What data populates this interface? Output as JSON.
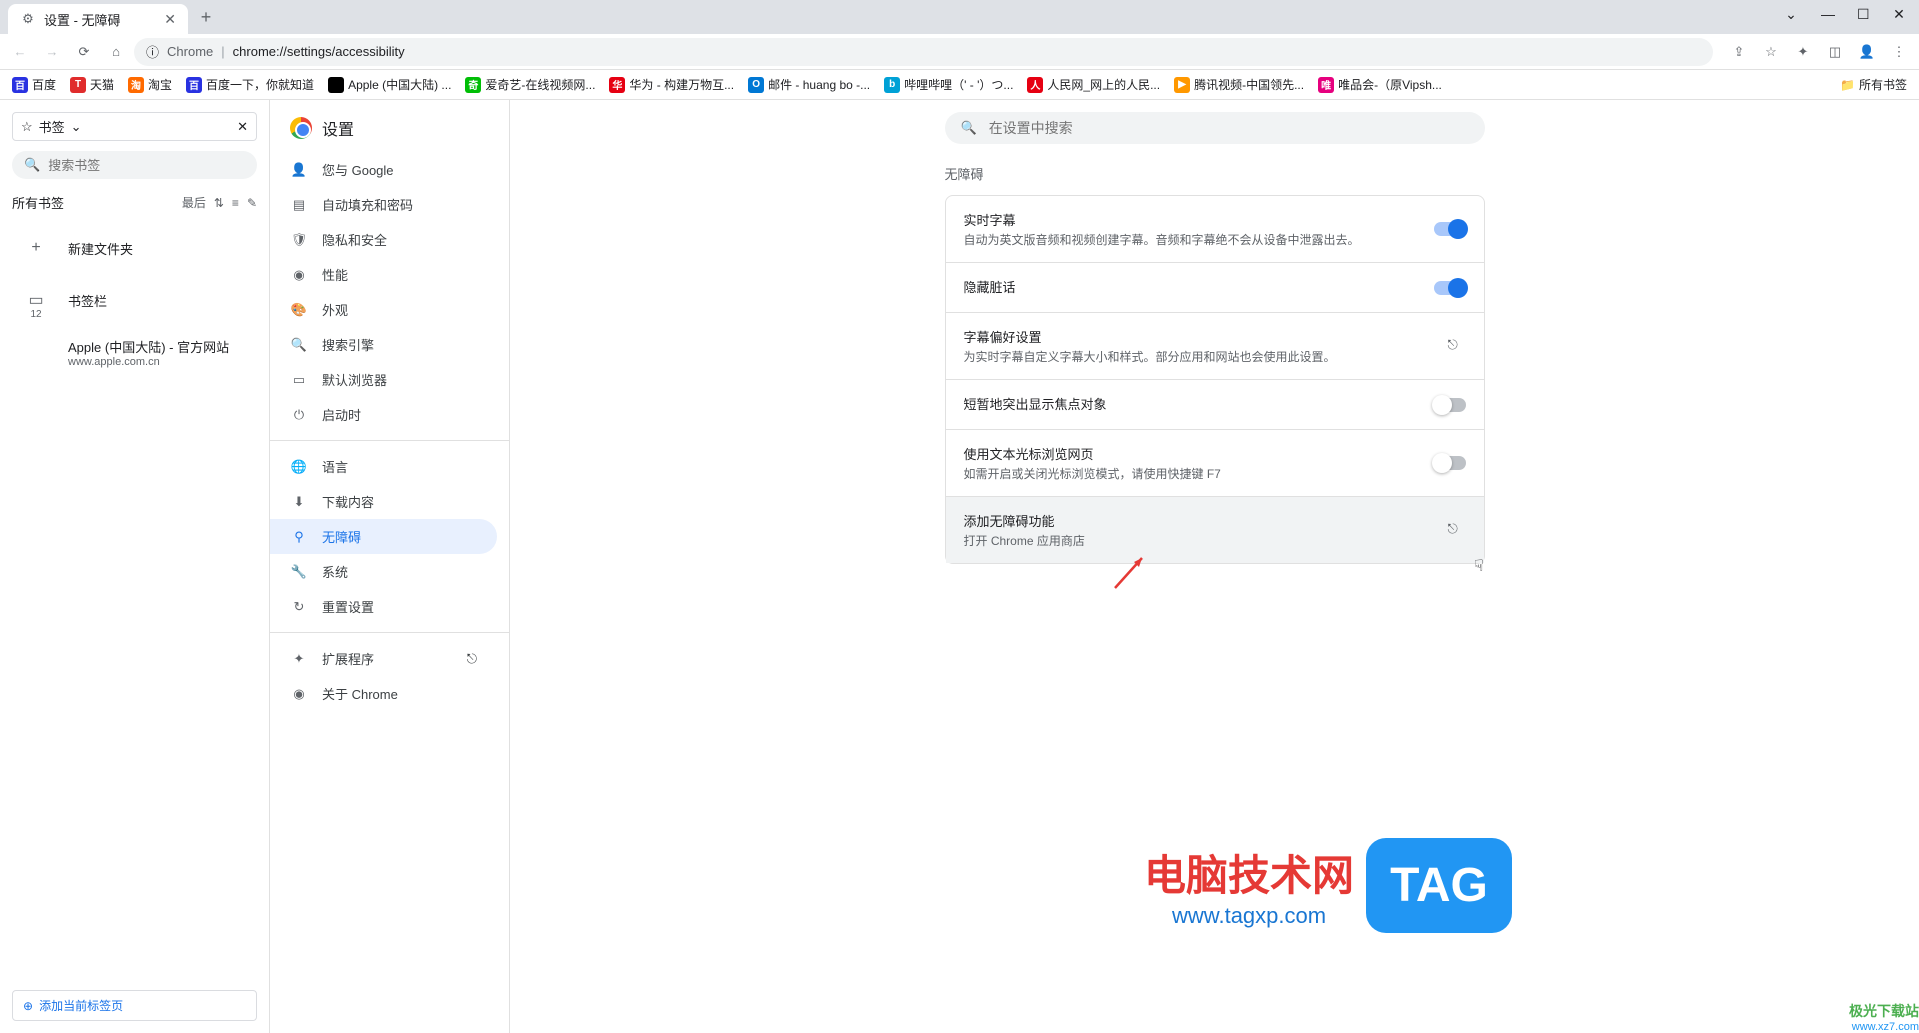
{
  "window": {
    "tab_title": "设置 - 无障碍"
  },
  "toolbar": {
    "chrome_label": "Chrome",
    "url": "chrome://settings/accessibility"
  },
  "bookmarks_bar": {
    "items": [
      {
        "label": "百度",
        "color": "#2932e1"
      },
      {
        "label": "天猫",
        "color": "#e02c2c"
      },
      {
        "label": "淘宝",
        "color": "#ff6a00"
      },
      {
        "label": "百度一下，你就知道",
        "color": "#2932e1"
      },
      {
        "label": "Apple (中国大陆) ...",
        "color": "#000"
      },
      {
        "label": "爱奇艺-在线视频网...",
        "color": "#00be06"
      },
      {
        "label": "华为 - 构建万物互...",
        "color": "#e60012"
      },
      {
        "label": "邮件 - huang bo -...",
        "color": "#0078d4"
      },
      {
        "label": "哔哩哔哩（' - '）つ...",
        "color": "#00a1d6"
      },
      {
        "label": "人民网_网上的人民...",
        "color": "#e60012"
      },
      {
        "label": "腾讯视频-中国领先...",
        "color": "#ff9800"
      },
      {
        "label": "唯品会-（原Vipsh...",
        "color": "#e6007e"
      }
    ],
    "right_label": "所有书签"
  },
  "bookmark_panel": {
    "dropdown_label": "书签",
    "search_placeholder": "搜索书签",
    "all_bookmarks": "所有书签",
    "sort_label": "最后",
    "new_folder": "新建文件夹",
    "bookmark_bar_label": "书签栏",
    "bookmark_bar_count": "12",
    "apple_title": "Apple (中国大陆) - 官方网站",
    "apple_url": "www.apple.com.cn",
    "add_current": "添加当前标签页"
  },
  "settings": {
    "title": "设置",
    "search_placeholder": "在设置中搜索",
    "nav": [
      {
        "icon": "person",
        "label": "您与 Google"
      },
      {
        "icon": "autofill",
        "label": "自动填充和密码"
      },
      {
        "icon": "privacy",
        "label": "隐私和安全"
      },
      {
        "icon": "performance",
        "label": "性能"
      },
      {
        "icon": "appearance",
        "label": "外观"
      },
      {
        "icon": "search",
        "label": "搜索引擎"
      },
      {
        "icon": "browser",
        "label": "默认浏览器"
      },
      {
        "icon": "startup",
        "label": "启动时"
      },
      {
        "icon": "language",
        "label": "语言"
      },
      {
        "icon": "download",
        "label": "下载内容"
      },
      {
        "icon": "accessibility",
        "label": "无障碍"
      },
      {
        "icon": "system",
        "label": "系统"
      },
      {
        "icon": "reset",
        "label": "重置设置"
      },
      {
        "icon": "extension",
        "label": "扩展程序"
      },
      {
        "icon": "about",
        "label": "关于 Chrome"
      }
    ],
    "section_title": "无障碍",
    "rows": [
      {
        "title": "实时字幕",
        "desc": "自动为英文版音频和视频创建字幕。音频和字幕绝不会从设备中泄露出去。",
        "control": "toggle_on"
      },
      {
        "title": "隐藏脏话",
        "desc": "",
        "control": "toggle_on"
      },
      {
        "title": "字幕偏好设置",
        "desc": "为实时字幕自定义字幕大小和样式。部分应用和网站也会使用此设置。",
        "control": "launch"
      },
      {
        "title": "短暂地突出显示焦点对象",
        "desc": "",
        "control": "toggle_off"
      },
      {
        "title": "使用文本光标浏览网页",
        "desc": "如需开启或关闭光标浏览模式，请使用快捷键 F7",
        "control": "toggle_off"
      },
      {
        "title": "添加无障碍功能",
        "desc": "打开 Chrome 应用商店",
        "control": "launch"
      }
    ]
  },
  "watermark": {
    "title": "电脑技术网",
    "url": "www.tagxp.com",
    "tag": "TAG",
    "corner1": "极光下载站",
    "corner2": "www.xz7.com"
  }
}
